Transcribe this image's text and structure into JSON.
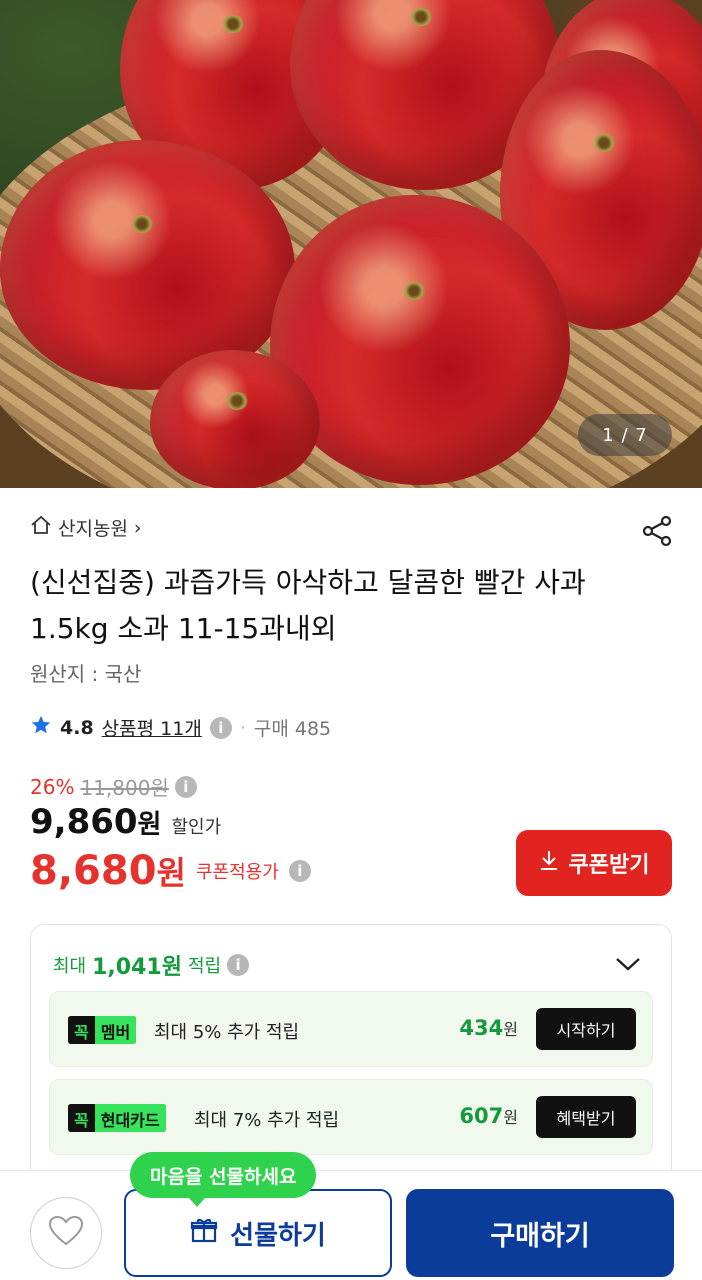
{
  "gallery": {
    "pager": "1 / 7"
  },
  "store": {
    "name": "산지농원",
    "arrow": "›"
  },
  "product": {
    "title": "(신선집중) 과즙가득 아삭하고 달콤한 빨간 사과 1.5kg 소과 11-15과내외",
    "origin": "원산지 : 국산"
  },
  "rating": {
    "score": "4.8",
    "reviews": "상품평 11개",
    "separator": "·",
    "sold": "구매 485"
  },
  "pricing": {
    "discount_rate": "26%",
    "original_price": "11,800원",
    "sale_price": "9,860",
    "won": "원",
    "sale_label": "할인가",
    "coupon_price": "8,680",
    "coupon_label": "쿠폰적용가",
    "coupon_button": "쿠폰받기",
    "accent": "#e12420"
  },
  "points": {
    "prefix": "최대",
    "amount": "1,041원",
    "suffix": "적립",
    "benefits": [
      {
        "tag_k": "꼭",
        "tag_name": "멤버",
        "desc": "최대 5% 추가 적립",
        "amount": "434",
        "unit": "원",
        "button": "시작하기"
      },
      {
        "tag_k": "꼭",
        "tag_name": "현대카드",
        "desc": "최대 7% 추가 적립",
        "amount": "607",
        "unit": "원",
        "button": "혜택받기"
      }
    ],
    "accent": "#139a3a"
  },
  "bottom_bar": {
    "gift_tooltip": "마음을 선물하세요",
    "gift_button": "선물하기",
    "buy_button": "구매하기",
    "brand": "#0c3c9a"
  },
  "icons": {
    "home": "home-icon",
    "share": "share-icon",
    "star": "star-icon",
    "info": "i",
    "download": "download-icon",
    "chevron": "chevron-down-icon",
    "heart": "heart-icon",
    "gift": "gift-icon"
  }
}
